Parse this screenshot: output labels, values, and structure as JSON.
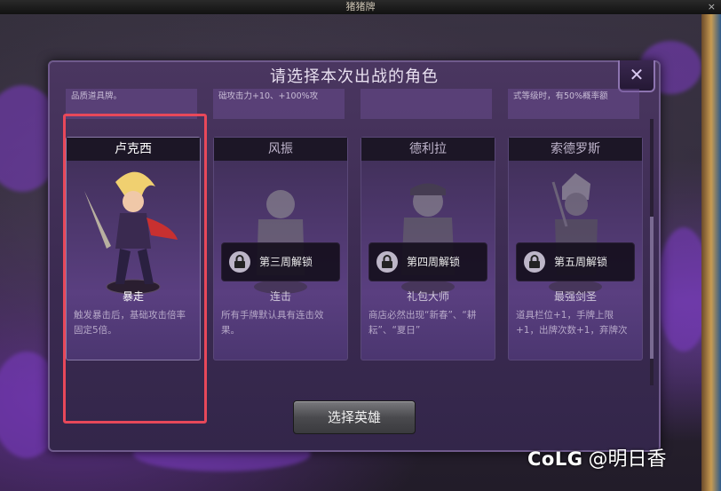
{
  "window": {
    "title": "猪猪牌",
    "close_glyph": "×"
  },
  "dialog": {
    "title": "请选择本次出战的角色",
    "close_glyph": "✕"
  },
  "top_row": {
    "items": [
      {
        "text": "品质道具牌。"
      },
      {
        "text": "础攻击力+10、+100%攻"
      },
      {
        "text": ""
      },
      {
        "text": "式等级时，有50%概率额"
      }
    ]
  },
  "cards": [
    {
      "name": "卢克西",
      "skill": "暴走",
      "desc": "触发暴击后，基础攻击倍率固定5倍。",
      "locked": false,
      "lock_text": ""
    },
    {
      "name": "风振",
      "skill": "连击",
      "desc": "所有手牌默认具有连击效果。",
      "locked": true,
      "lock_text": "第三周解锁"
    },
    {
      "name": "德利拉",
      "skill": "礼包大师",
      "desc": "商店必然出现“新春”、“耕耘”、“夏日”",
      "locked": true,
      "lock_text": "第四周解锁"
    },
    {
      "name": "索德罗斯",
      "skill": "最强剑圣",
      "desc": "道具栏位+1，手牌上限+1，出牌次数+1，弃牌次",
      "locked": true,
      "lock_text": "第五周解锁"
    }
  ],
  "buttons": {
    "select_hero": "选择英雄"
  },
  "watermark": {
    "logo": "CoLG",
    "text": "@明日香"
  },
  "colors": {
    "selection_frame": "#e8485a",
    "accent_purple": "#7d3cc6"
  }
}
